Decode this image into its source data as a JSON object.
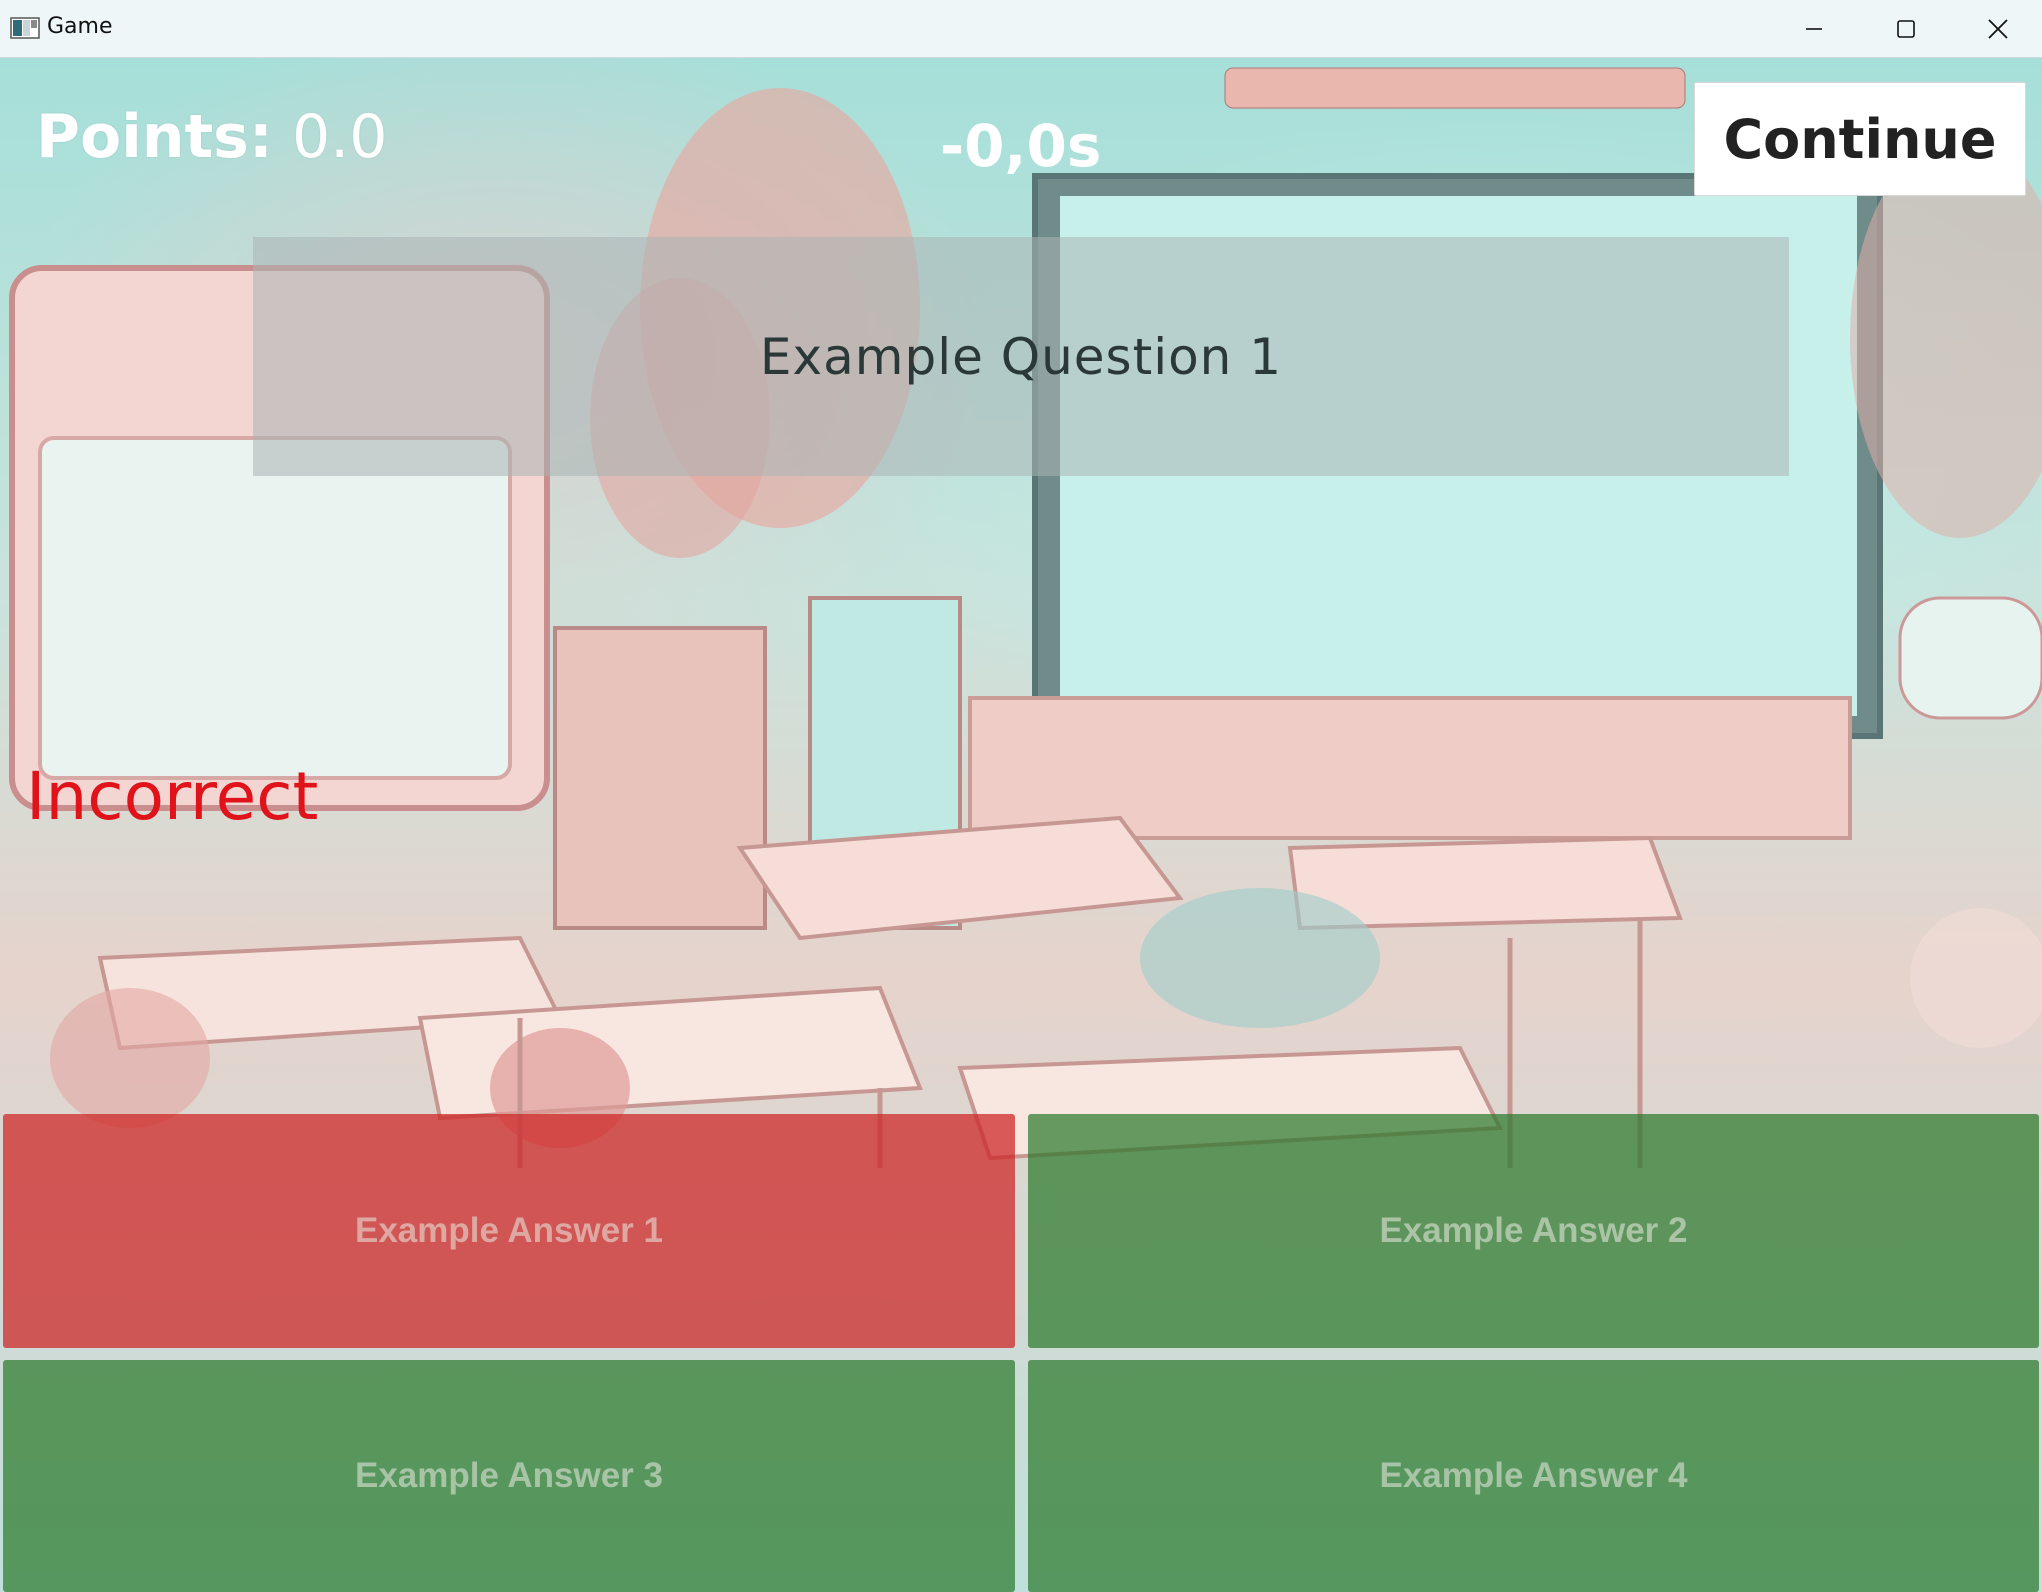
{
  "window": {
    "title": "Game",
    "controls": [
      "minimize-icon",
      "maximize-icon",
      "close-icon"
    ]
  },
  "hud": {
    "points_label": "Points:",
    "points_value": "0.0",
    "timer": "-0,0s",
    "continue_label": "Continue"
  },
  "question": {
    "text": "Example Question 1"
  },
  "feedback": {
    "text": "Incorrect",
    "color": "#e0121a"
  },
  "answers": [
    {
      "label": "Example Answer 1",
      "state": "incorrect",
      "color": "#cd2323"
    },
    {
      "label": "Example Answer 2",
      "state": "correct",
      "color": "#287828"
    },
    {
      "label": "Example Answer 3",
      "state": "correct",
      "color": "#287828"
    },
    {
      "label": "Example Answer 4",
      "state": "correct",
      "color": "#287828"
    }
  ]
}
